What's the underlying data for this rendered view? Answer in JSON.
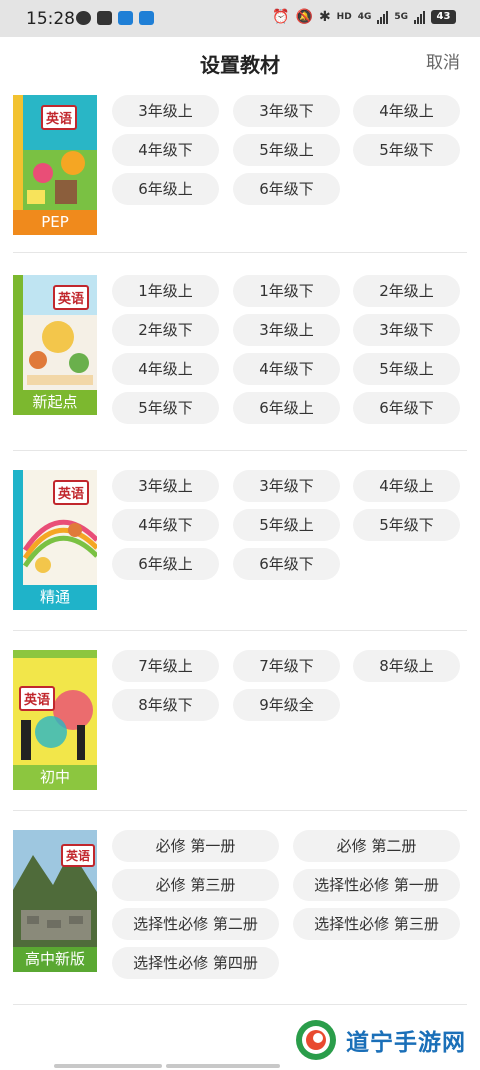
{
  "status_bar": {
    "time": "15:28",
    "network_1": "4G",
    "network_2": "5G",
    "battery": "43"
  },
  "header": {
    "title": "设置教材",
    "cancel_label": "取消"
  },
  "books": [
    {
      "label": "PEP",
      "label_color": "#f08a1c",
      "grades": [
        "3年级上",
        "3年级下",
        "4年级上",
        "4年级下",
        "5年级上",
        "5年级下",
        "6年级上",
        "6年级下"
      ]
    },
    {
      "label": "新起点",
      "label_color": "#7cb82f",
      "grades": [
        "1年级上",
        "1年级下",
        "2年级上",
        "2年级下",
        "3年级上",
        "3年级下",
        "4年级上",
        "4年级下",
        "5年级上",
        "5年级下",
        "6年级上",
        "6年级下"
      ]
    },
    {
      "label": "精通",
      "label_color": "#1fb3c9",
      "grades": [
        "3年级上",
        "3年级下",
        "4年级上",
        "4年级下",
        "5年级上",
        "5年级下",
        "6年级上",
        "6年级下"
      ]
    },
    {
      "label": "初中",
      "label_color": "#8cc63f",
      "grades": [
        "7年级上",
        "7年级下",
        "8年级上",
        "8年级下",
        "9年级全"
      ]
    },
    {
      "label": "高中新版",
      "label_color": "#5aa832",
      "grades": [
        "必修 第一册",
        "必修 第二册",
        "必修 第三册",
        "选择性必修 第一册",
        "选择性必修 第二册",
        "选择性必修 第三册",
        "选择性必修 第四册"
      ]
    }
  ],
  "cover_title": "英语",
  "watermark": {
    "text": "道宁手游网"
  }
}
